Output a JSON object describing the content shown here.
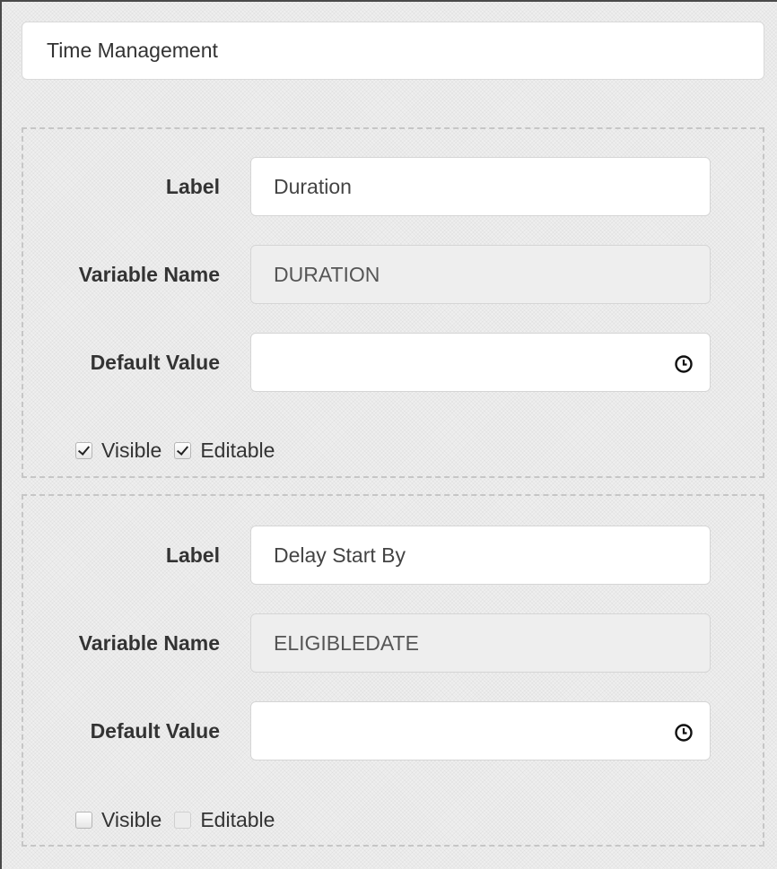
{
  "title": "Time Management",
  "sections": [
    {
      "label_caption": "Label",
      "label_value": "Duration",
      "variable_caption": "Variable Name",
      "variable_value": "DURATION",
      "default_caption": "Default Value",
      "default_value": "",
      "default_icon": "clock-icon",
      "visible_label": "Visible",
      "visible_checked": true,
      "editable_label": "Editable",
      "editable_checked": true
    },
    {
      "label_caption": "Label",
      "label_value": "Delay Start By",
      "variable_caption": "Variable Name",
      "variable_value": "ELIGIBLEDATE",
      "default_caption": "Default Value",
      "default_value": "",
      "default_icon": "clock-icon",
      "visible_label": "Visible",
      "visible_checked": false,
      "editable_label": "Editable",
      "editable_checked": false
    }
  ],
  "colors": {
    "panel_background": "#efefef",
    "input_background": "#ffffff",
    "disabled_input_background": "#eeeeee",
    "text": "#333333"
  }
}
